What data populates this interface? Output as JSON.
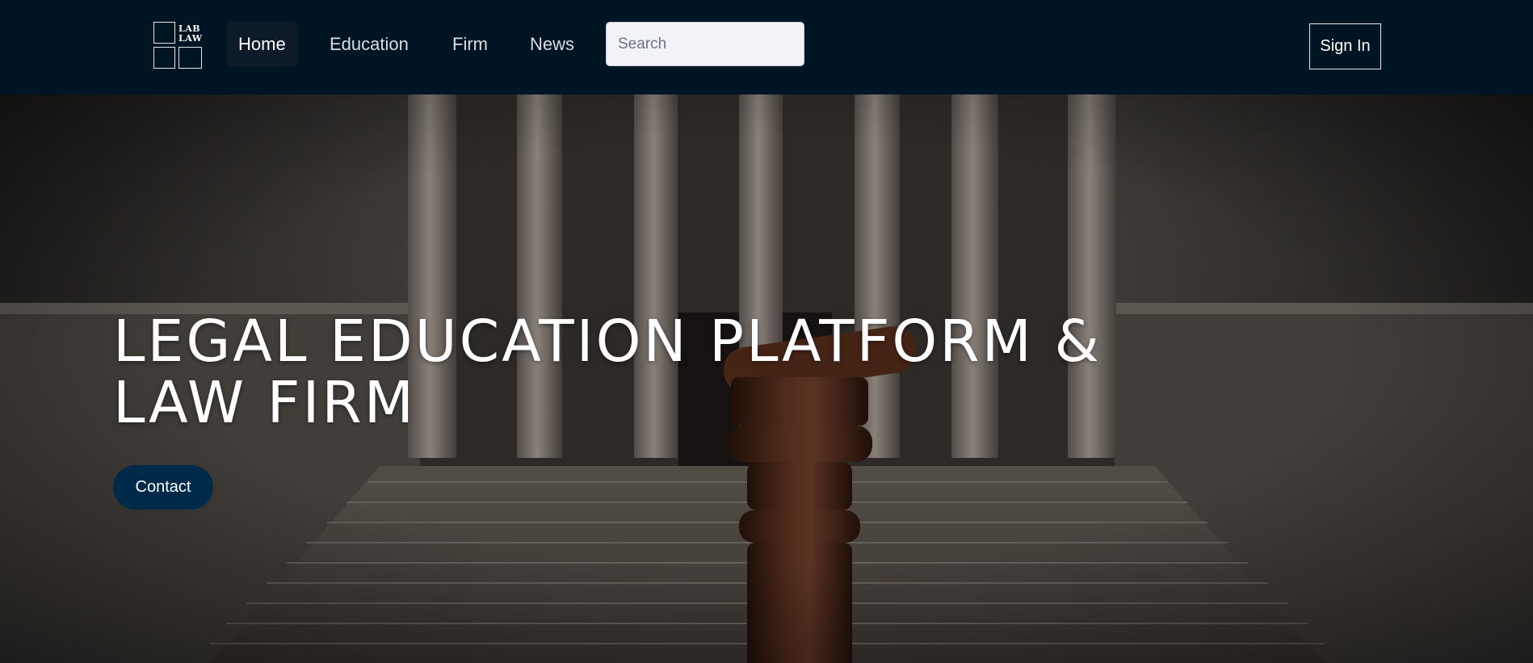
{
  "logo": {
    "line1": "LAB",
    "line2": "LAW"
  },
  "nav": {
    "items": [
      {
        "label": "Home",
        "active": true
      },
      {
        "label": "Education",
        "active": false
      },
      {
        "label": "Firm",
        "active": false
      },
      {
        "label": "News",
        "active": false
      }
    ],
    "search_placeholder": "Search",
    "search_value": "",
    "signin_label": "Sign In"
  },
  "hero": {
    "title_line1": "LEGAL EDUCATION PLATFORM &",
    "title_line2": "LAW FIRM",
    "contact_label": "Contact",
    "image_subject": "courthouse-with-gavel"
  },
  "colors": {
    "navbar_bg": "#001523",
    "active_nav_bg": "#0d1b29",
    "contact_bg": "#002a4a",
    "text": "#ffffff"
  }
}
